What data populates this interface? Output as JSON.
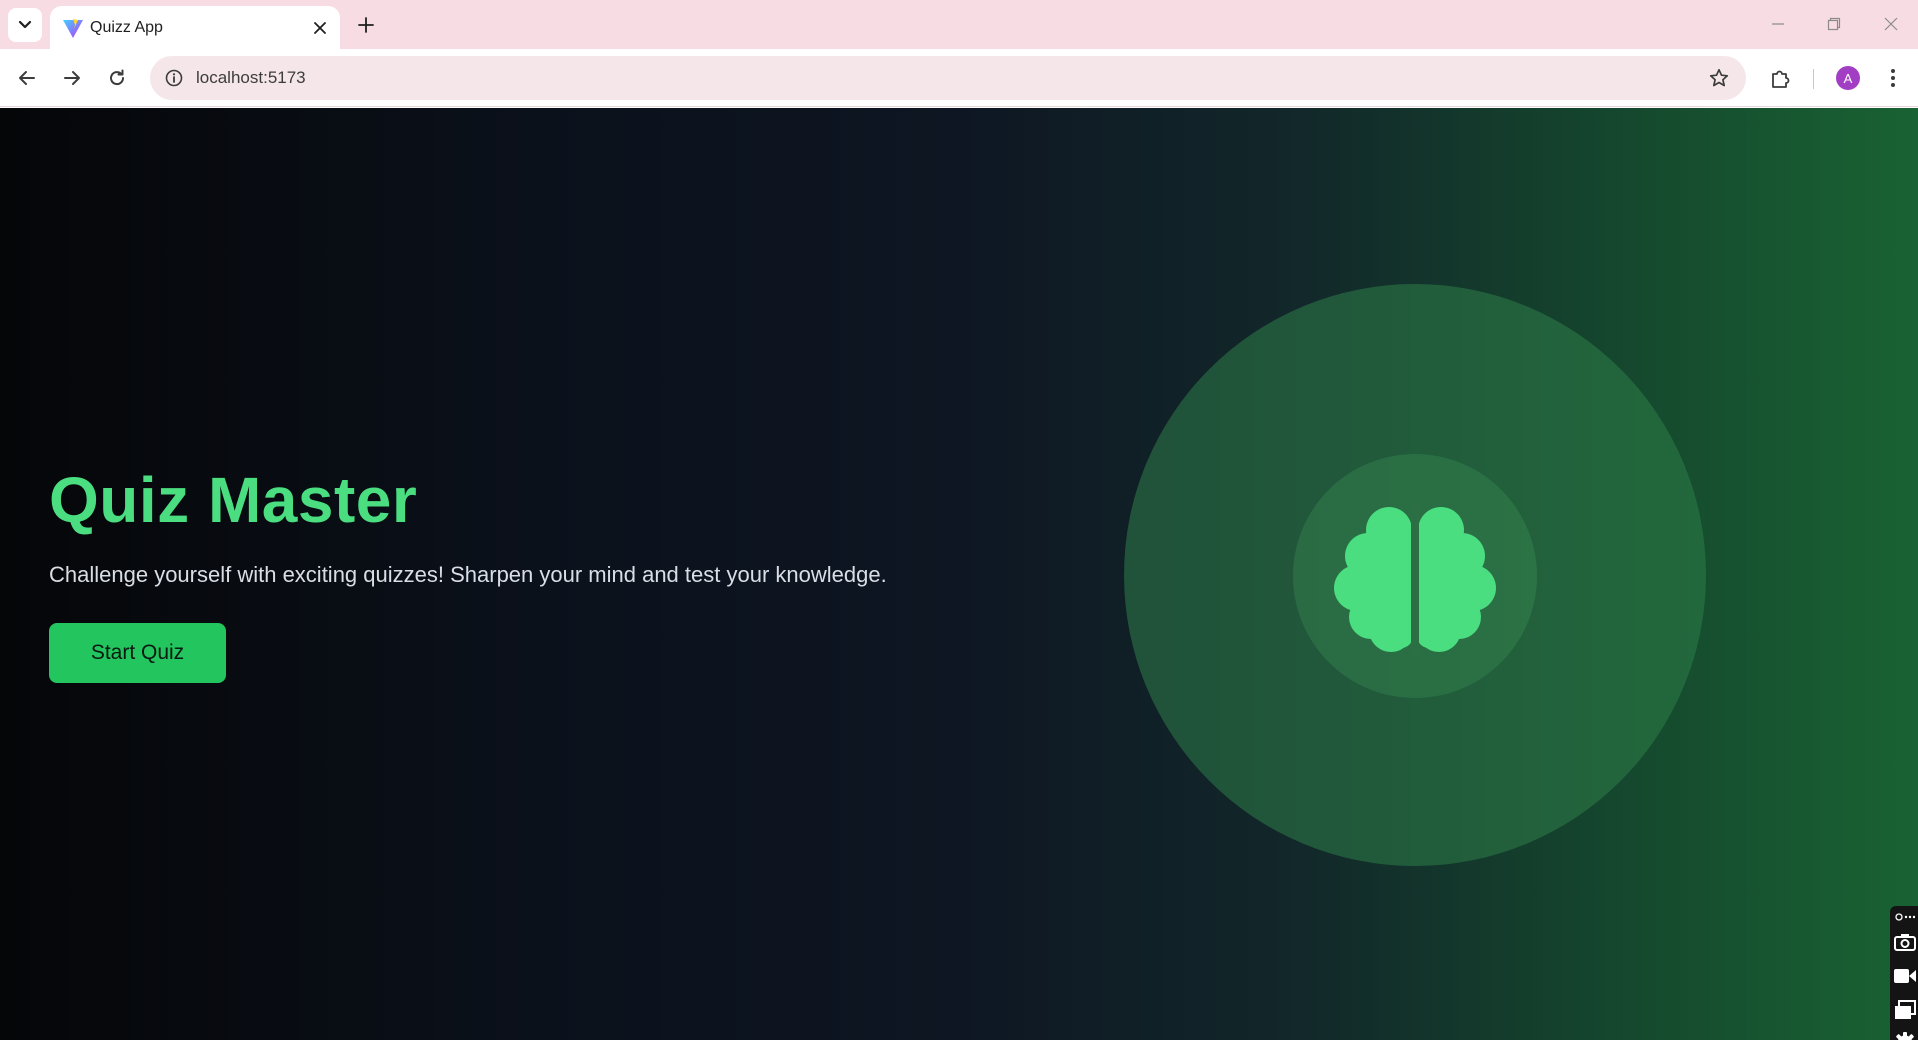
{
  "browser": {
    "tab": {
      "title": "Quizz App"
    },
    "address_bar": {
      "url": "localhost:5173"
    },
    "profile": {
      "initial": "A"
    }
  },
  "page": {
    "title": "Quiz Master",
    "subtitle": "Challenge yourself with exciting quizzes! Sharpen your mind and test your knowledge.",
    "start_button_label": "Start Quiz",
    "hero_icon": "brain-icon"
  },
  "colors": {
    "accent": "#4ade80",
    "button": "#22c55e",
    "tabstrip": "#f7dde3",
    "avatar": "#a23ec4"
  },
  "side_widget": {
    "icons": [
      "camera-icon",
      "video-icon",
      "screens-icon",
      "gear-icon"
    ]
  }
}
